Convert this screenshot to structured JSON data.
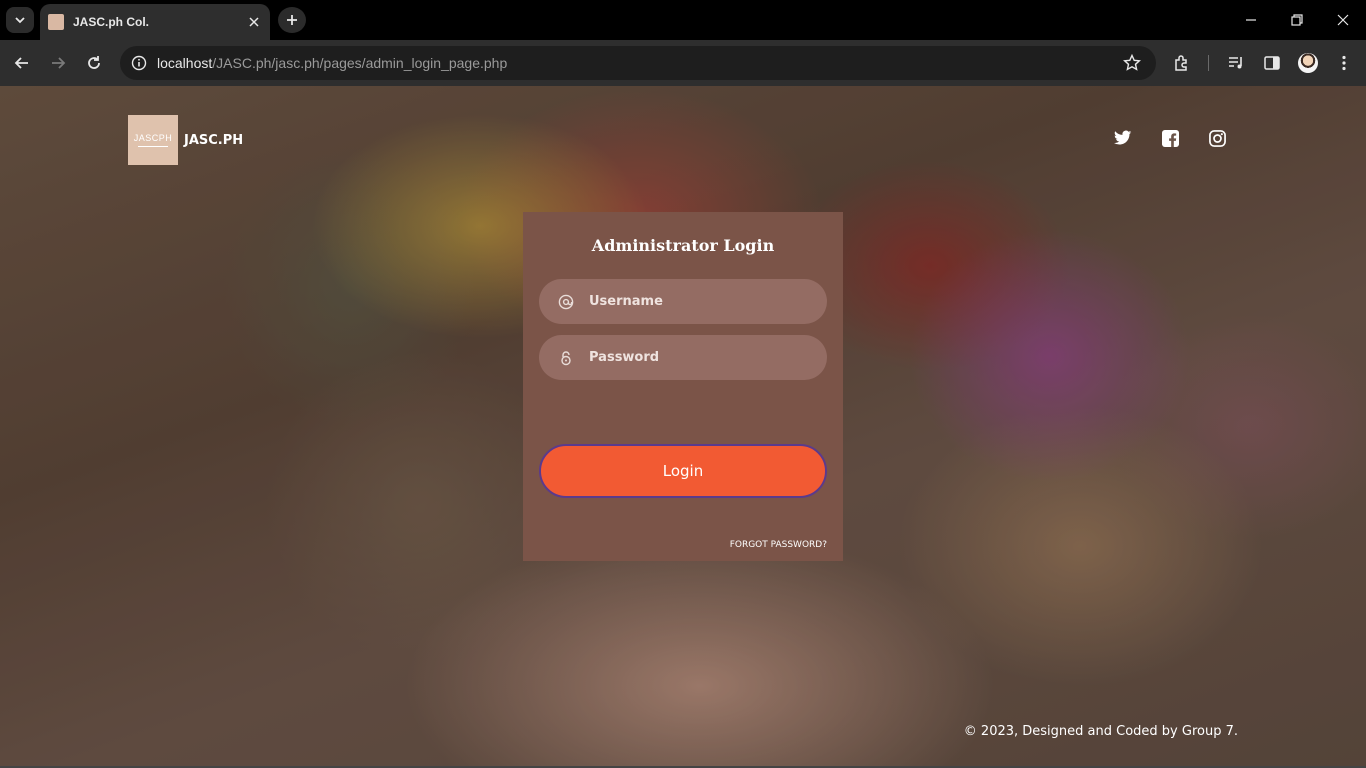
{
  "browser": {
    "tab_title": "JASC.ph Col.",
    "url_host": "localhost",
    "url_path": "/JASC.ph/jasc.ph/pages/admin_login_page.php"
  },
  "header": {
    "logo_text": "JASCPH",
    "brand_name": "JASC.PH",
    "social_icons": [
      "twitter-icon",
      "facebook-icon",
      "instagram-icon"
    ]
  },
  "login": {
    "title": "Administrator Login",
    "username_placeholder": "Username",
    "password_placeholder": "Password",
    "button_label": "Login",
    "forgot_label": "FORGOT PASSWORD?"
  },
  "footer": {
    "text": "© 2023, Designed and Coded by Group 7."
  },
  "colors": {
    "card_bg": "#7b5448",
    "field_bg": "#946c63",
    "button_bg": "#f25a33",
    "button_border": "#5b3a8c",
    "logo_bg": "#dfc2ad"
  }
}
